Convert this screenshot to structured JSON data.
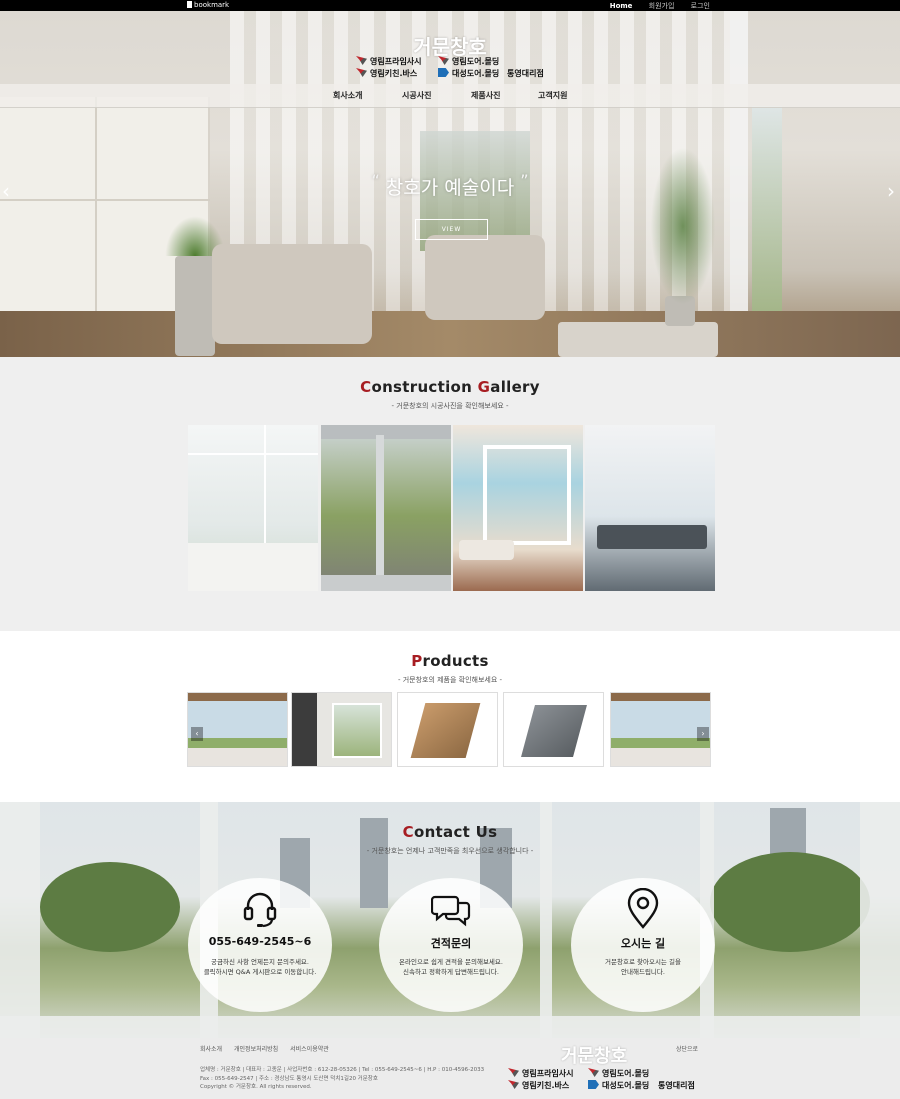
{
  "topbar": {
    "bookmark": "bookmark",
    "links": [
      "Home",
      "회원가입",
      "로그인"
    ]
  },
  "site": {
    "title": "거문창호",
    "brands": [
      "영림프라임사시",
      "영림도어.몰딩",
      "영림키친.바스",
      "대성도어.몰딩",
      "통영대리점"
    ]
  },
  "nav": [
    "회사소개",
    "시공사진",
    "제품사진",
    "고객지원"
  ],
  "hero": {
    "open_quote": "“",
    "caption": "창호가 예술이다",
    "close_quote": "”",
    "button": "VIEW",
    "prev": "‹",
    "next": "›"
  },
  "gallery": {
    "title_first": "C",
    "title_rest1": "onstruction ",
    "title_g": "G",
    "title_rest2": "allery",
    "subtitle": "- 거문창호의 시공사진을 확인해보세요 -"
  },
  "products": {
    "title_first": "P",
    "title_rest": "roducts",
    "subtitle": "- 거문창호의 제품을 확인해보세요 -",
    "prev": "‹",
    "next": "›"
  },
  "contact": {
    "title_first": "C",
    "title_rest": "ontact Us",
    "subtitle": "- 거문창호는 언제나 고객만족을 최우선으로 생각합니다 -",
    "cards": [
      {
        "icon": "headset-icon",
        "title": "055-649-2545~6",
        "desc1": "궁금하신 사항 언제든지 문의주세요.",
        "desc2": "클릭하시면 Q&A 게시판으로 이동합니다."
      },
      {
        "icon": "chat-bubbles-icon",
        "title": "견적문의",
        "desc1": "온라인으로 쉽게 견적을 문의해보세요.",
        "desc2": "신속하고 정확하게 답변해드립니다."
      },
      {
        "icon": "location-pin-icon",
        "title": "오시는 길",
        "desc1": "거문창호로 찾아오시는 길을",
        "desc2": "안내해드립니다."
      }
    ]
  },
  "footer": {
    "links": [
      "회사소개",
      "개인정보처리방침",
      "서비스이용약관"
    ],
    "top": "상단으로",
    "line1": "업체명 : 거문창호 | 대표자 : 고종운 | 사업자번호 : 612-28-05326 | Tel : 055-649-2545~6 | H.P : 010-4596-2033",
    "line2": "Fax : 055-649-2547 | 주소 : 경상남도 통영시 도산면 덕치1길20 거문창호",
    "line3": "Copyright © 거문창호. All rights reserved."
  },
  "colors": {
    "accent_red": "#a71d22",
    "topbar": "#000000"
  }
}
